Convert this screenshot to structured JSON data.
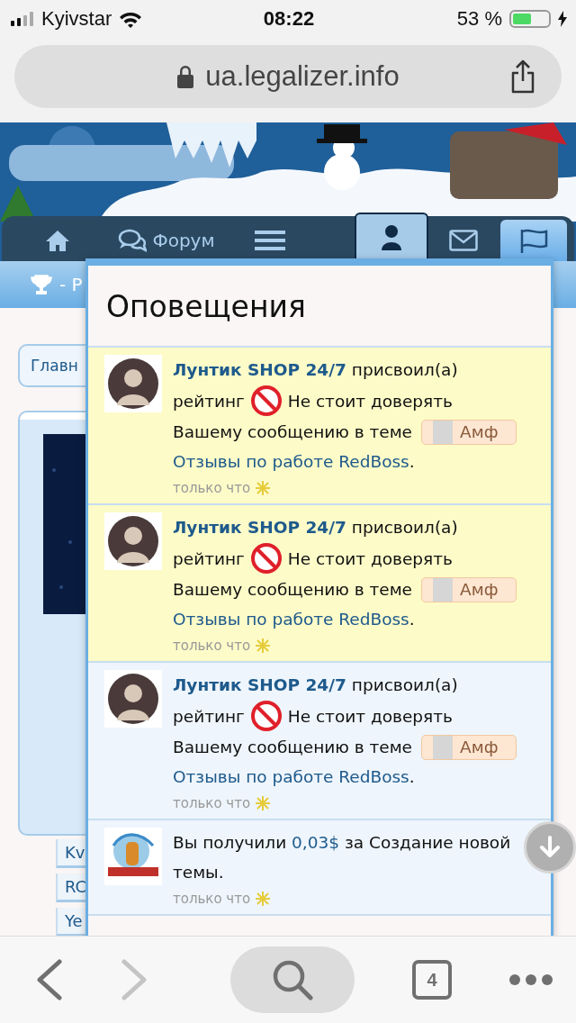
{
  "status_bar": {
    "carrier": "Kyivstar",
    "time": "08:22",
    "battery_text": "53 %",
    "battery": {
      "level": 0.53
    }
  },
  "address_bar": {
    "url": "ua.legalizer.info"
  },
  "nav": [
    {
      "kind": "home",
      "selected": false
    },
    {
      "kind": "forum",
      "label": "Форум",
      "selected": false
    },
    {
      "kind": "menu",
      "selected": false
    },
    {
      "kind": "user",
      "selected": true
    },
    {
      "kind": "mail",
      "selected": false
    },
    {
      "kind": "flag",
      "selected": true
    }
  ],
  "subbar": {
    "text": "- Р"
  },
  "page": {
    "breadcrumb": "Главн",
    "tags": [
      "Kv",
      "RC",
      "Ye"
    ]
  },
  "notifications": {
    "title": "Оповещения",
    "items": [
      {
        "kind": "rating",
        "unread": true,
        "author": "Лунтик SHOP 24/7",
        "action": "присвоил(а)",
        "rating_label": "рейтинг",
        "rating": "Не стоит доверять",
        "context": "Вашему сообщению в теме",
        "prefix": "Амф",
        "thread": "Отзывы по работе RedBoss",
        "end": ".",
        "time": "только что"
      },
      {
        "kind": "rating",
        "unread": true,
        "author": "Лунтик SHOP 24/7",
        "action": "присвоил(а)",
        "rating_label": "рейтинг",
        "rating": "Не стоит доверять",
        "context": "Вашему сообщению в теме",
        "prefix": "Амф",
        "thread": "Отзывы по работе RedBoss",
        "end": ".",
        "time": "только что"
      },
      {
        "kind": "rating",
        "unread": false,
        "author": "Лунтик SHOP 24/7",
        "action": "присвоил(а)",
        "rating_label": "рейтинг",
        "rating": "Не стоит доверять",
        "context": "Вашему сообщению в теме",
        "prefix": "Амф",
        "thread": "Отзывы по работе RedBoss",
        "end": ".",
        "time": "только что"
      },
      {
        "kind": "payment",
        "unread": false,
        "lead": "Вы получили",
        "amount": "0,03$",
        "rest": "за Создание новой темы.",
        "time": "только что"
      }
    ]
  },
  "toolbar": {
    "tab_count": "4",
    "forward_disabled": true
  }
}
